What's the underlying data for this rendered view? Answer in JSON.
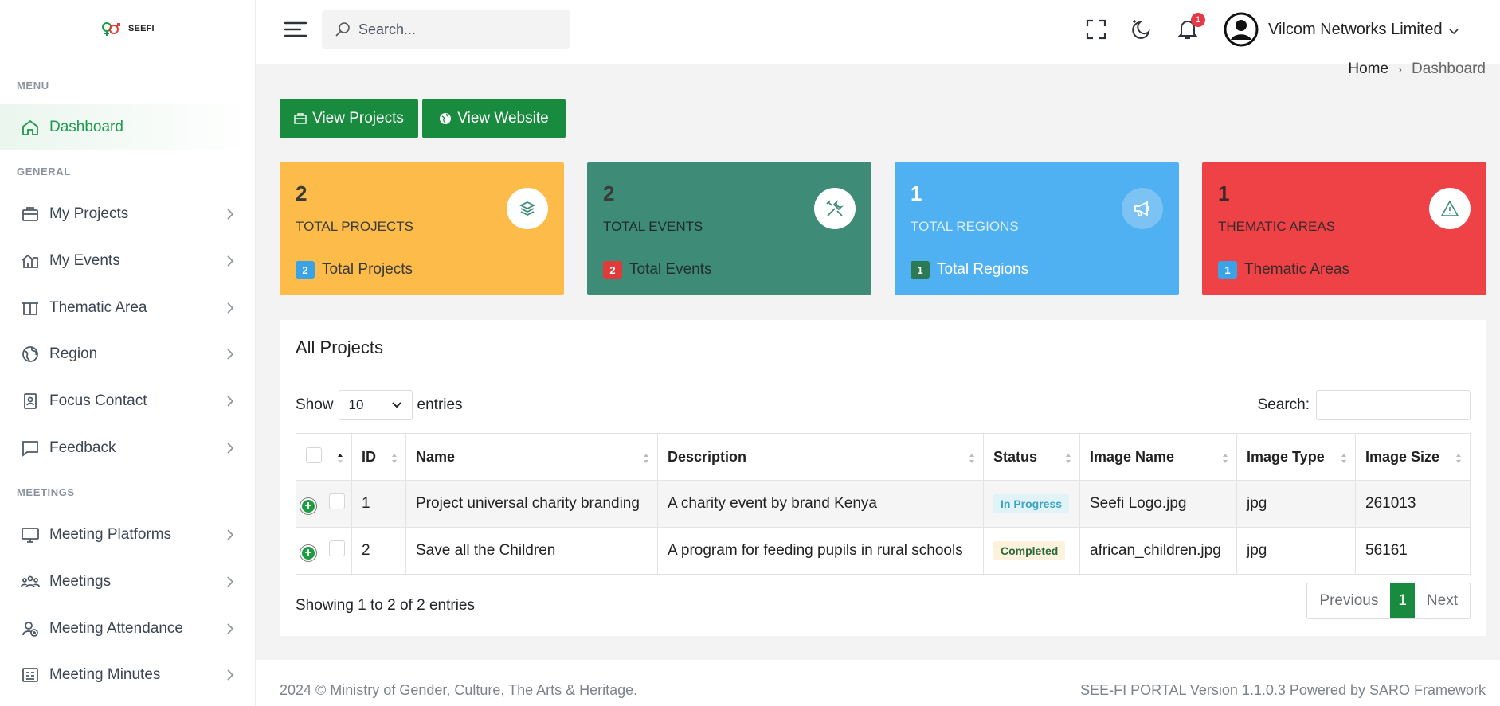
{
  "brand": {
    "logo_text": "SEEFI"
  },
  "sidebar": {
    "sections": {
      "menu": "MENU",
      "general": "GENERAL",
      "meetings": "MEETINGS"
    },
    "items": [
      {
        "label": "Dashboard",
        "icon": "home-icon"
      },
      {
        "label": "My Projects",
        "icon": "briefcase-icon"
      },
      {
        "label": "My Events",
        "icon": "house-icon"
      },
      {
        "label": "Thematic Area",
        "icon": "book-icon"
      },
      {
        "label": "Region",
        "icon": "globe-icon"
      },
      {
        "label": "Focus Contact",
        "icon": "contact-icon"
      },
      {
        "label": "Feedback",
        "icon": "chat-icon"
      },
      {
        "label": "Meeting Platforms",
        "icon": "monitor-icon"
      },
      {
        "label": "Meetings",
        "icon": "people-icon"
      },
      {
        "label": "Meeting Attendance",
        "icon": "user-add-icon"
      },
      {
        "label": "Meeting Minutes",
        "icon": "notes-icon"
      }
    ]
  },
  "header": {
    "search_placeholder": "Search...",
    "notification_count": "1",
    "user_name": "Vilcom Networks Limited"
  },
  "breadcrumb": {
    "home": "Home",
    "current": "Dashboard"
  },
  "actions": {
    "view_projects": "View Projects",
    "view_website": "View Website"
  },
  "cards": [
    {
      "number": "2",
      "label": "TOTAL PROJECTS",
      "badge": "2",
      "footer": "Total Projects",
      "bg": "#fdbc49",
      "badge_bg": "#3aa3e8",
      "icon": "layers-icon"
    },
    {
      "number": "2",
      "label": "TOTAL EVENTS",
      "badge": "2",
      "footer": "Total Events",
      "bg": "#3e8b78",
      "badge_bg": "#e03b3b",
      "icon": "tools-icon"
    },
    {
      "number": "1",
      "label": "TOTAL REGIONS",
      "badge": "1",
      "footer": "Total Regions",
      "bg": "#4fb0f2",
      "badge_bg": "#2c7a55",
      "icon": "megaphone-icon"
    },
    {
      "number": "1",
      "label": "THEMATIC AREAS",
      "badge": "1",
      "footer": "Thematic Areas",
      "bg": "#ef4246",
      "badge_bg": "#3aa3e8",
      "icon": "warning-icon"
    }
  ],
  "projects": {
    "title": "All Projects",
    "show_label": "Show",
    "entries_label": "entries",
    "page_length": "10",
    "search_label": "Search:",
    "columns": [
      "ID",
      "Name",
      "Description",
      "Status",
      "Image Name",
      "Image Type",
      "Image Size"
    ],
    "rows": [
      {
        "id": "1",
        "name": "Project universal charity branding",
        "description": "A charity event by brand Kenya",
        "status": "In Progress",
        "image_name": "Seefi Logo.jpg",
        "image_type": "jpg",
        "image_size": "261013"
      },
      {
        "id": "2",
        "name": "Save all the Children",
        "description": "A program for feeding pupils in rural schools",
        "status": "Completed",
        "image_name": "african_children.jpg",
        "image_type": "jpg",
        "image_size": "56161"
      }
    ],
    "info": "Showing 1 to 2 of 2 entries",
    "pagination": {
      "previous": "Previous",
      "page": "1",
      "next": "Next"
    }
  },
  "footer": {
    "left": "2024 © Ministry of Gender, Culture, The Arts & Heritage.",
    "right": "SEE-FI PORTAL Version 1.1.0.3 Powered by SARO Framework"
  }
}
